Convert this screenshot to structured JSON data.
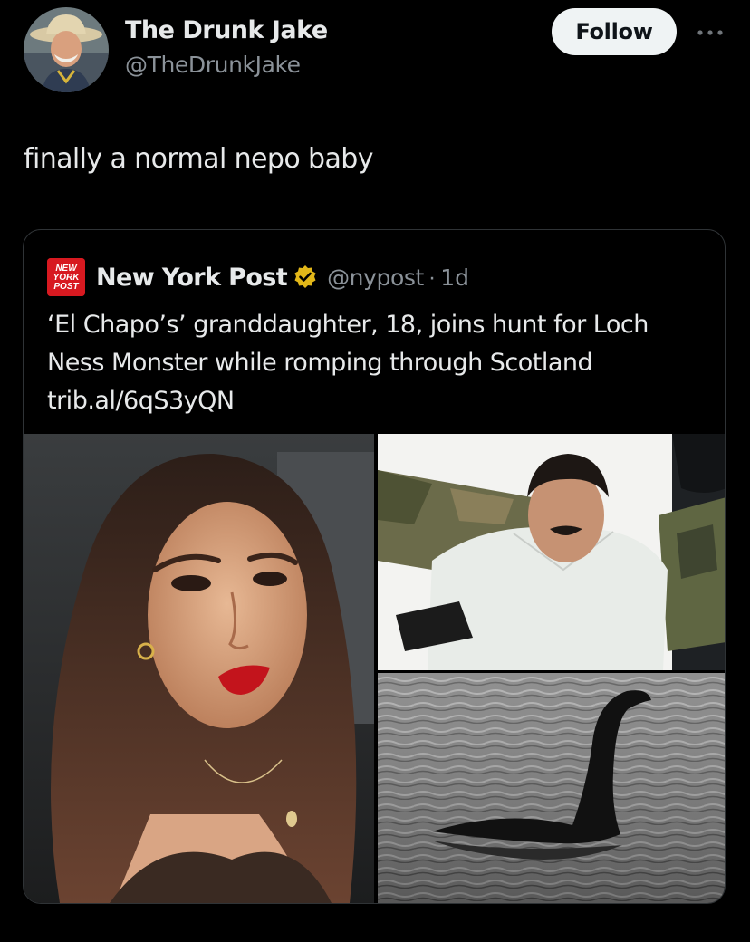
{
  "tweet": {
    "author": {
      "display_name": "The Drunk Jake",
      "handle": "@TheDrunkJake",
      "avatar": "avatar-cowboy-hat-photo"
    },
    "follow_label": "Follow",
    "more_icon": "ellipsis-icon",
    "text": "finally a normal nepo baby"
  },
  "quote": {
    "source_logo": "NEW YORK POST",
    "source_name": "New York Post",
    "verified_icon": "verified-gold-badge-icon",
    "handle": "@nypost",
    "separator": "·",
    "time": "1d",
    "body_lines": [
      "‘El Chapo’s’ granddaughter, 18, joins hunt for Loch",
      "Ness Monster while romping through Scotland",
      "trib.al/6qS3yQN"
    ],
    "media": [
      {
        "name": "photo-woman-portrait"
      },
      {
        "name": "photo-man-escorted-by-soldiers"
      },
      {
        "name": "photo-loch-ness-monster"
      }
    ]
  },
  "colors": {
    "background": "#000000",
    "primary_text": "#e7e9ea",
    "secondary_text": "#8b9299",
    "follow_button_bg": "#eff3f4",
    "border": "#2f3336",
    "verified_gold": "#e2b719",
    "nyp_red": "#d71920"
  }
}
